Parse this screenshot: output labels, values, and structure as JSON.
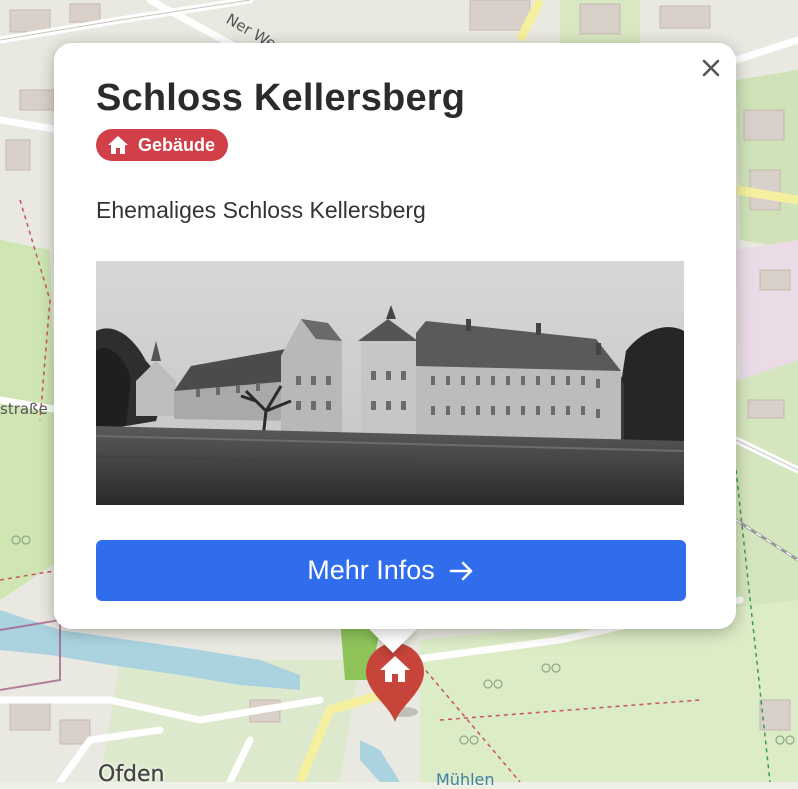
{
  "map": {
    "labels": {
      "street_top": "Ner We",
      "street_left": "straße",
      "place_bottom": "Ofden",
      "place_bottom_right": "Mühlen"
    }
  },
  "popup": {
    "title": "Schloss Kellersberg",
    "category": {
      "label": "Gebäude",
      "icon": "house-icon",
      "color": "#d13f48"
    },
    "description": "Ehemaliges Schloss Kellersberg",
    "image": {
      "subject": "castle-photo"
    },
    "button": {
      "label": "Mehr Infos",
      "icon": "arrow-right-icon",
      "color": "#2f6ded"
    },
    "close_icon": "close-icon"
  },
  "marker": {
    "icon": "house-icon",
    "color": "#c7443a"
  }
}
